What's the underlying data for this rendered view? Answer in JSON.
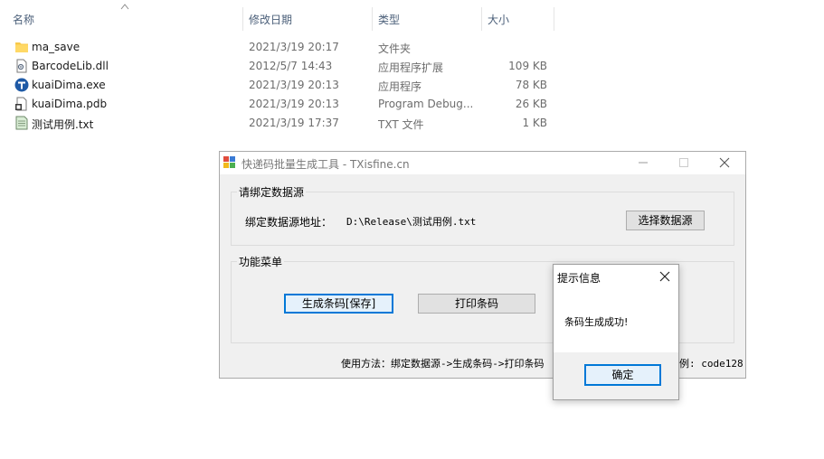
{
  "explorer": {
    "columns": {
      "name": "名称",
      "date": "修改日期",
      "type": "类型",
      "size": "大小"
    },
    "files": [
      {
        "icon": "folder-icon",
        "name": "ma_save",
        "date": "2021/3/19 20:17",
        "type": "文件夹",
        "size": ""
      },
      {
        "icon": "dll-icon",
        "name": "BarcodeLib.dll",
        "date": "2012/5/7 14:43",
        "type": "应用程序扩展",
        "size": "109 KB"
      },
      {
        "icon": "exe-icon",
        "name": "kuaiDima.exe",
        "date": "2021/3/19 20:13",
        "type": "应用程序",
        "size": "78 KB"
      },
      {
        "icon": "pdb-icon",
        "name": "kuaiDima.pdb",
        "date": "2021/3/19 20:13",
        "type": "Program Debug...",
        "size": "26 KB"
      },
      {
        "icon": "txt-icon",
        "name": "测试用例.txt",
        "date": "2021/3/19 17:37",
        "type": "TXT 文件",
        "size": "1 KB"
      }
    ]
  },
  "app": {
    "title": "快递码批量生成工具 - TXisfine.cn",
    "source_group": {
      "label": "请绑定数据源",
      "address_label": "绑定数据源地址：",
      "path": "D:\\Release\\测试用例.txt",
      "select_button": "选择数据源"
    },
    "menu_group": {
      "label": "功能菜单",
      "generate_button": "生成条码[保存]",
      "print_button": "打印条码"
    },
    "usage": "使用方法：绑定数据源->生成条码->打印条码",
    "usage_tail": "例: code128"
  },
  "message_box": {
    "title": "提示信息",
    "text": "条码生成成功!",
    "ok_button": "确定"
  },
  "colors": {
    "accent": "#0078d7",
    "header_text": "#4c607a",
    "folder": "#f8c94a"
  }
}
